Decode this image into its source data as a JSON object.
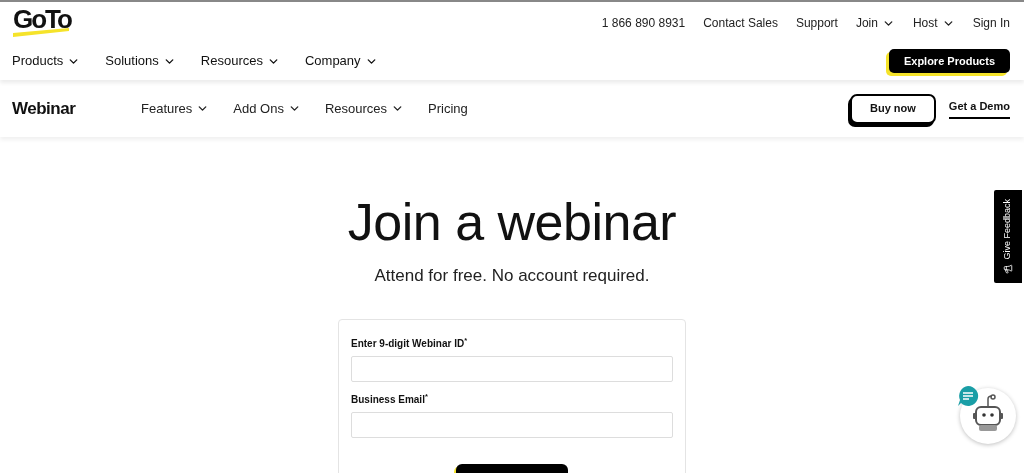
{
  "header": {
    "logo": "GoTo",
    "utility_links": [
      {
        "label": "1 866 890 8931",
        "dropdown": false
      },
      {
        "label": "Contact Sales",
        "dropdown": false
      },
      {
        "label": "Support",
        "dropdown": false
      },
      {
        "label": "Join",
        "dropdown": true
      },
      {
        "label": "Host",
        "dropdown": true
      },
      {
        "label": "Sign In",
        "dropdown": false
      }
    ],
    "main_nav": [
      {
        "label": "Products",
        "dropdown": true
      },
      {
        "label": "Solutions",
        "dropdown": true
      },
      {
        "label": "Resources",
        "dropdown": true
      },
      {
        "label": "Company",
        "dropdown": true
      }
    ],
    "cta": "Explore Products"
  },
  "product_nav": {
    "title": "Webinar",
    "items": [
      {
        "label": "Features",
        "dropdown": true
      },
      {
        "label": "Add Ons",
        "dropdown": true
      },
      {
        "label": "Resources",
        "dropdown": true
      },
      {
        "label": "Pricing",
        "dropdown": false
      }
    ],
    "buy_button": "Buy now",
    "demo_link": "Get a Demo"
  },
  "hero": {
    "title": "Join a webinar",
    "subtitle": "Attend for free. No account required."
  },
  "form": {
    "fields": [
      {
        "label": "Enter 9-digit Webinar ID",
        "required_mark": "*"
      },
      {
        "label": "Business Email",
        "required_mark": "*"
      }
    ]
  },
  "feedback_tab": "Give Feedback"
}
